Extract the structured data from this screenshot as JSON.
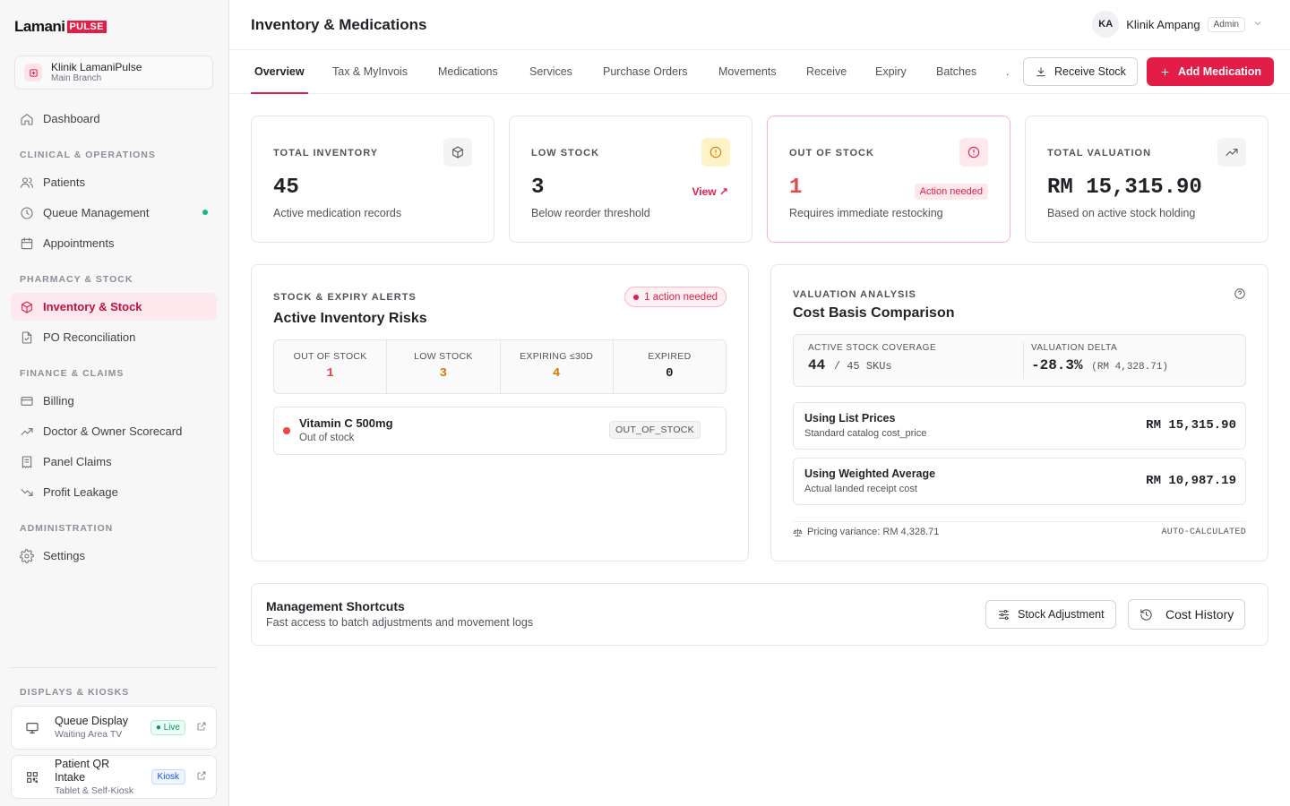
{
  "brand": {
    "word": "Lamani",
    "tag": "PULSE"
  },
  "clinic": {
    "name": "Klinik LamaniPulse",
    "branch": "Main Branch"
  },
  "nav": {
    "dashboard": "Dashboard",
    "section_clinical": "CLINICAL & OPERATIONS",
    "patients": "Patients",
    "queue": "Queue Management",
    "appointments": "Appointments",
    "section_pharmacy": "PHARMACY & STOCK",
    "inventory": "Inventory & Stock",
    "po_reconciliation": "PO Reconciliation",
    "section_finance": "FINANCE & CLAIMS",
    "billing": "Billing",
    "scorecard": "Doctor & Owner Scorecard",
    "panel_claims": "Panel Claims",
    "profit_leakage": "Profit Leakage",
    "section_admin": "ADMINISTRATION",
    "settings": "Settings"
  },
  "displays": {
    "section": "DISPLAYS & KIOSKS",
    "queue_display": {
      "title": "Queue Display",
      "sub": "Waiting Area TV",
      "badge": "● Live"
    },
    "qr_intake": {
      "title": "Patient QR Intake",
      "sub": "Tablet & Self-Kiosk",
      "badge": "Kiosk"
    }
  },
  "header": {
    "title": "Inventory & Medications",
    "user": {
      "initials": "KA",
      "name": "Klinik Ampang",
      "role": "Admin"
    }
  },
  "tabs": [
    "Overview",
    "Tax & MyInvois",
    "Medications",
    "Services",
    "Purchase Orders",
    "Movements",
    "Receive",
    "Expiry",
    "Batches",
    "."
  ],
  "actions": {
    "receive_stock": "Receive Stock",
    "add_medication": "Add Medication"
  },
  "stats": {
    "total_inventory": {
      "label": "TOTAL INVENTORY",
      "value": "45",
      "sub": "Active medication records"
    },
    "low_stock": {
      "label": "LOW STOCK",
      "value": "3",
      "sub": "Below reorder threshold",
      "link": "View ↗"
    },
    "out_of_stock": {
      "label": "OUT OF STOCK",
      "value": "1",
      "sub": "Requires immediate restocking",
      "chip": "Action needed"
    },
    "total_valuation": {
      "label": "TOTAL VALUATION",
      "value": "RM 15,315.90",
      "sub": "Based on active stock holding"
    }
  },
  "alerts": {
    "kicker": "STOCK & EXPIRY ALERTS",
    "title": "Active Inventory Risks",
    "pill": "1 action needed",
    "summary": [
      {
        "label": "OUT OF STOCK",
        "value": "1"
      },
      {
        "label": "LOW STOCK",
        "value": "3"
      },
      {
        "label": "EXPIRING ≤30D",
        "value": "4"
      },
      {
        "label": "EXPIRED",
        "value": "0"
      }
    ],
    "items": [
      {
        "name": "Vitamin C 500mg",
        "status": "Out of stock",
        "code": "OUT_OF_STOCK"
      }
    ]
  },
  "valuation": {
    "kicker": "VALUATION ANALYSIS",
    "title": "Cost Basis Comparison",
    "coverage_label": "ACTIVE STOCK COVERAGE",
    "coverage_value": "44",
    "coverage_total": "/ 45 SKUs",
    "delta_label": "VALUATION DELTA",
    "delta_value": "-28.3%",
    "delta_amount": "(RM 4,328.71)",
    "list_title": "Using List Prices",
    "list_sub": "Standard catalog cost_price",
    "list_value": "RM 15,315.90",
    "wavg_title": "Using Weighted Average",
    "wavg_sub": "Actual landed receipt cost",
    "wavg_value": "RM 10,987.19",
    "variance": "Pricing variance: RM 4,328.71",
    "auto": "AUTO-CALCULATED"
  },
  "shortcuts": {
    "title": "Management Shortcuts",
    "sub": "Fast access to batch adjustments and movement logs",
    "stock_adjustment": "Stock Adjustment",
    "cost_history": "Cost History"
  },
  "colors": {
    "accent": "#e11d48",
    "out_of_stock": "#e5484d",
    "low_stock": "#d97706",
    "expiring": "#d97706",
    "live": "#10b981"
  }
}
